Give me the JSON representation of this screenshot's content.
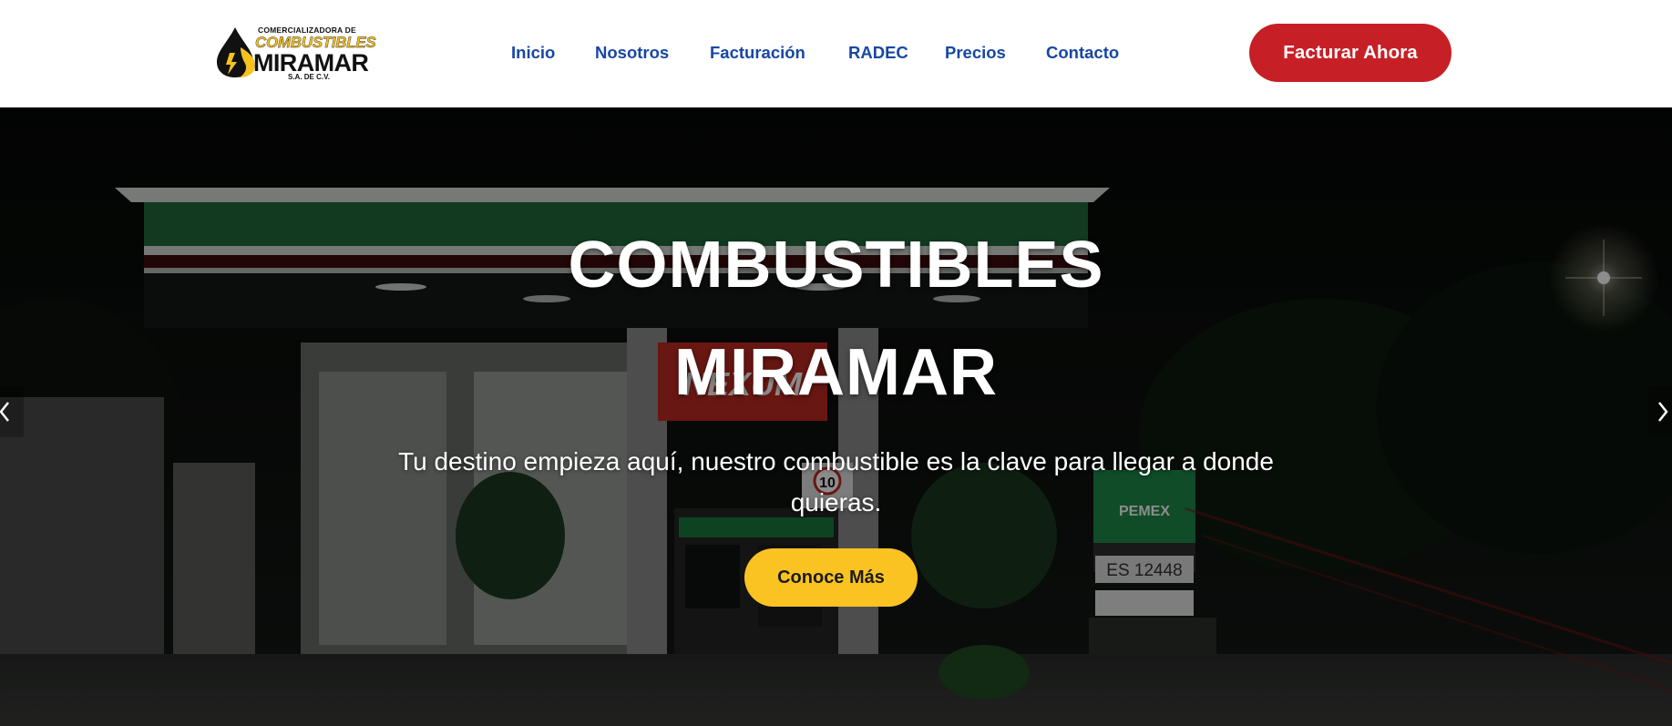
{
  "logo": {
    "top_line": "COMERCIALIZADORA DE",
    "middle_line": "COMBUSTIBLES",
    "main_line": "MIRAMAR",
    "sub_line": "S.A. DE C.V.",
    "icon": "fuel-drop-icon"
  },
  "nav": {
    "items": [
      {
        "label": "Inicio"
      },
      {
        "label": "Nosotros"
      },
      {
        "label": "Facturación"
      },
      {
        "label": "RADEC"
      },
      {
        "label": "Precios"
      },
      {
        "label": "Contacto"
      }
    ]
  },
  "header_cta": {
    "label": "Facturar Ahora"
  },
  "hero": {
    "title_line1": "COMBUSTIBLES",
    "title_line2": "MIRAMAR",
    "subtitle": "Tu destino empieza aquí, nuestro combustible es la clave para llegar a donde quieras.",
    "cta_label": "Conoce Más",
    "photo_text": {
      "brand_sign": "NEXUM",
      "pump_number": "10",
      "station_code": "ES 12448",
      "pemex_sign": "PEMEX"
    },
    "prev_icon": "chevron-left-icon",
    "next_icon": "chevron-right-icon"
  },
  "colors": {
    "nav_text": "#1747a3",
    "header_cta_bg": "#c62026",
    "hero_cta_bg": "#fbc321",
    "brand_yellow": "#f6c21d",
    "white": "#ffffff"
  }
}
